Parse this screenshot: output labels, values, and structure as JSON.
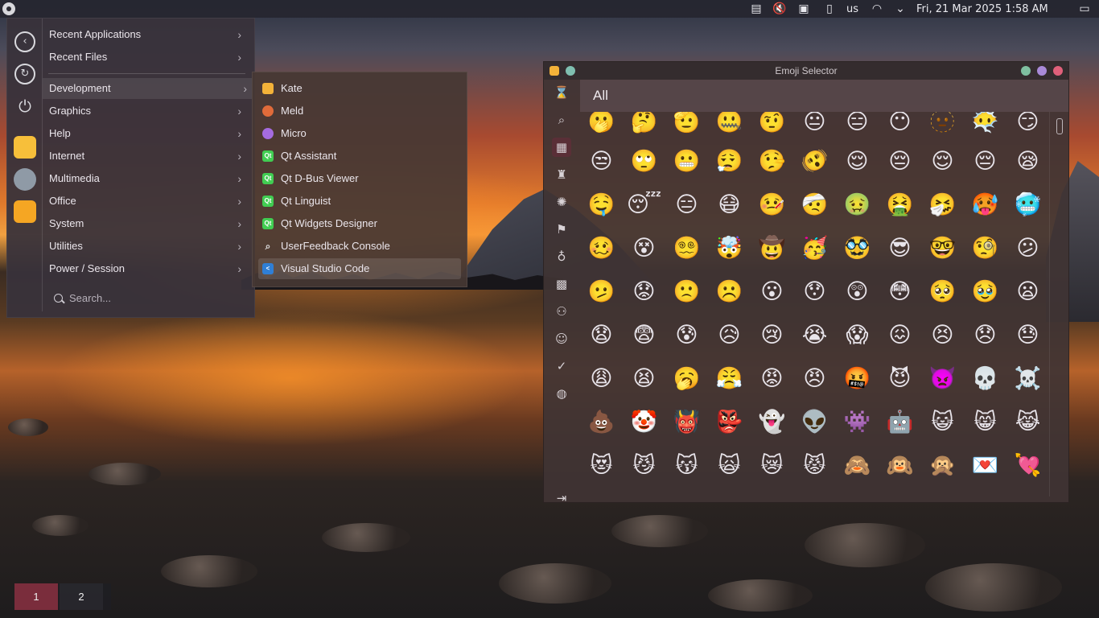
{
  "panel": {
    "keyboard_layout": "us",
    "clock": "Fri, 21 Mar 2025  1:58 AM",
    "tray_icons": [
      "clipboard-icon",
      "speaker-muted-icon",
      "display-icon",
      "usb-icon",
      "wifi-icon",
      "chevron-down-icon",
      "window-icon"
    ]
  },
  "launcher": {
    "favorites": [
      "back-icon",
      "refresh-icon",
      "power-icon",
      "files-app-icon",
      "settings-app-icon",
      "brave-app-icon"
    ],
    "categories": [
      {
        "label": "Recent Applications"
      },
      {
        "label": "Recent Files"
      },
      {
        "label": "Development"
      },
      {
        "label": "Graphics"
      },
      {
        "label": "Help"
      },
      {
        "label": "Internet"
      },
      {
        "label": "Multimedia"
      },
      {
        "label": "Office"
      },
      {
        "label": "System"
      },
      {
        "label": "Utilities"
      },
      {
        "label": "Power / Session"
      }
    ],
    "search_placeholder": "Search..."
  },
  "submenu": {
    "items": [
      {
        "label": "Kate",
        "icon": "kate-icon",
        "color": "#f3b239"
      },
      {
        "label": "Meld",
        "icon": "meld-icon",
        "color": "#e06b3a"
      },
      {
        "label": "Micro",
        "icon": "micro-icon",
        "color": "#a56be0"
      },
      {
        "label": "Qt Assistant",
        "icon": "qt-icon",
        "color": "#41cd52"
      },
      {
        "label": "Qt D-Bus Viewer",
        "icon": "qt-icon",
        "color": "#41cd52"
      },
      {
        "label": "Qt Linguist",
        "icon": "qt-icon",
        "color": "#41cd52"
      },
      {
        "label": "Qt Widgets Designer",
        "icon": "qt-icon",
        "color": "#41cd52"
      },
      {
        "label": "UserFeedback Console",
        "icon": "search-icon",
        "color": "transparent"
      },
      {
        "label": "Visual Studio Code",
        "icon": "vscode-icon",
        "color": "#2f7fd6"
      }
    ]
  },
  "emoji_window": {
    "title": "Emoji Selector",
    "category_header": "All",
    "categories": [
      "recent-icon",
      "search-icon",
      "all-icon",
      "activities-icon",
      "objects-icon",
      "flags-icon",
      "food-icon",
      "symbols-icon",
      "people-icon",
      "smileys-icon",
      "check-icon",
      "travel-icon",
      "expand-icon"
    ],
    "emojis": [
      [
        "🫢",
        "🤔",
        "🫡",
        "🤐",
        "🤨",
        "😐",
        "😑",
        "😶",
        "🫥",
        "😶‍🌫️",
        "😏"
      ],
      [
        "😒",
        "🙄",
        "😬",
        "😮‍💨",
        "🤥",
        "🫨",
        "😌",
        "😔",
        "😌",
        "😔",
        "😪"
      ],
      [
        "🤤",
        "😴",
        "😑",
        "😷",
        "🤒",
        "🤕",
        "🤢",
        "🤮",
        "🤧",
        "🥵",
        "🥶"
      ],
      [
        "🥴",
        "😵",
        "😵‍💫",
        "🤯",
        "🤠",
        "🥳",
        "🥸",
        "😎",
        "🤓",
        "🧐",
        "😕"
      ],
      [
        "🫤",
        "😟",
        "🙁",
        "☹️",
        "😮",
        "😯",
        "😲",
        "😳",
        "🥺",
        "🥹",
        "😦"
      ],
      [
        "😧",
        "😨",
        "😰",
        "😥",
        "😢",
        "😭",
        "😱",
        "😖",
        "😣",
        "😞",
        "😓"
      ],
      [
        "😩",
        "😫",
        "🥱",
        "😤",
        "😡",
        "😠",
        "🤬",
        "😈",
        "👿",
        "💀",
        "☠️"
      ],
      [
        "💩",
        "🤡",
        "👹",
        "👺",
        "👻",
        "👽",
        "👾",
        "🤖",
        "😺",
        "😸",
        "😹"
      ],
      [
        "😻",
        "😼",
        "😽",
        "🙀",
        "😿",
        "😾",
        "🙈",
        "🙉",
        "🙊",
        "💌",
        "💘"
      ]
    ]
  },
  "pager": {
    "desktops": [
      "1",
      "2"
    ]
  }
}
